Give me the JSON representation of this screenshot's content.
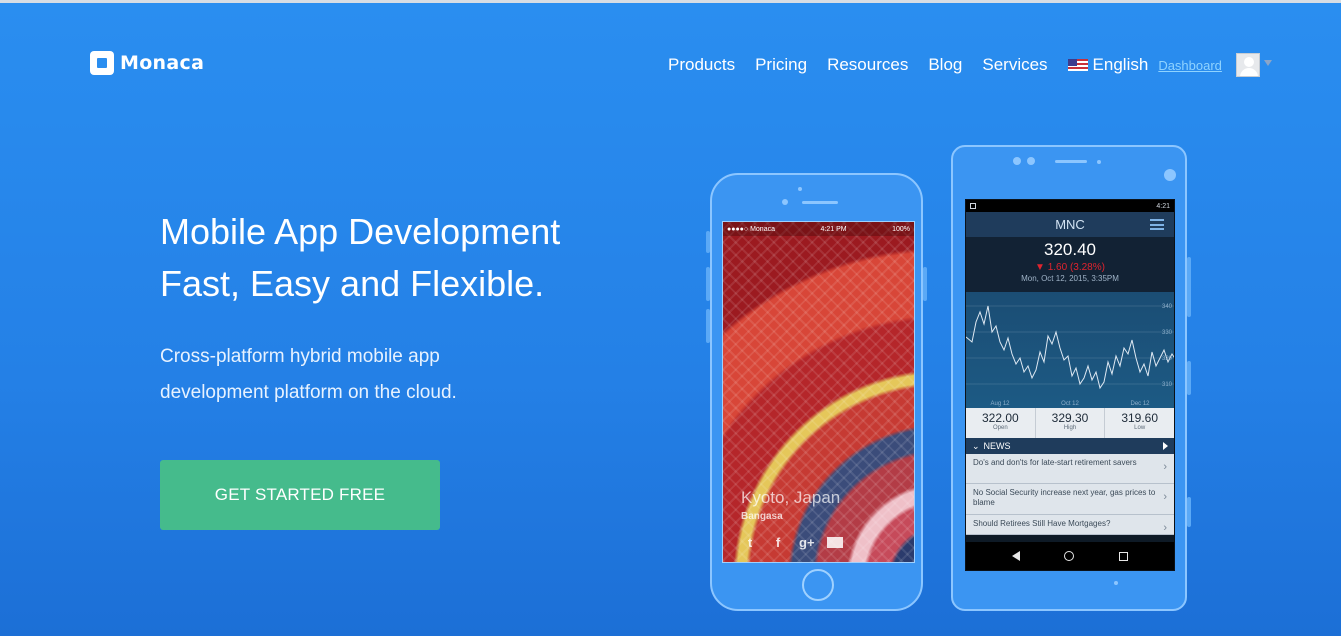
{
  "brand": {
    "name": "Monaca"
  },
  "nav": {
    "items": [
      "Products",
      "Pricing",
      "Resources",
      "Blog",
      "Services"
    ],
    "language": "English",
    "dashboard": "Dashboard"
  },
  "hero": {
    "title_line1": "Mobile App Development",
    "title_line2": "Fast, Easy and Flexible.",
    "sub_line1": "Cross-platform hybrid mobile app",
    "sub_line2": "development platform on the cloud.",
    "cta": "GET STARTED FREE"
  },
  "iphone_mock": {
    "carrier": "●●●●○ Monaca",
    "time": "4:21 PM",
    "battery": "100%",
    "place": "Kyoto, Japan",
    "caption": "Bangasa"
  },
  "android_mock": {
    "time": "4:21",
    "app_title": "MNC",
    "price": "320.40",
    "change": "▼ 1.60 (3.28%)",
    "date": "Mon, Oct 12, 2015, 3:35PM",
    "chart_labels": {
      "y": [
        "340",
        "330",
        "320",
        "310"
      ],
      "x": [
        "Aug 12",
        "Oct 12",
        "Dec 12"
      ]
    },
    "stats": [
      {
        "value": "322.00",
        "label": "Open"
      },
      {
        "value": "329.30",
        "label": "High"
      },
      {
        "value": "319.60",
        "label": "Low"
      }
    ],
    "news_header": "NEWS",
    "news": [
      "Do's and don'ts for late-start retirement savers",
      "No Social Security increase next year, gas prices to blame",
      "Should Retirees Still Have Mortgages?"
    ]
  },
  "colors": {
    "background": "#2a8ef0",
    "cta": "#45bb8c",
    "dashboard_link": "#8fd3ff"
  }
}
